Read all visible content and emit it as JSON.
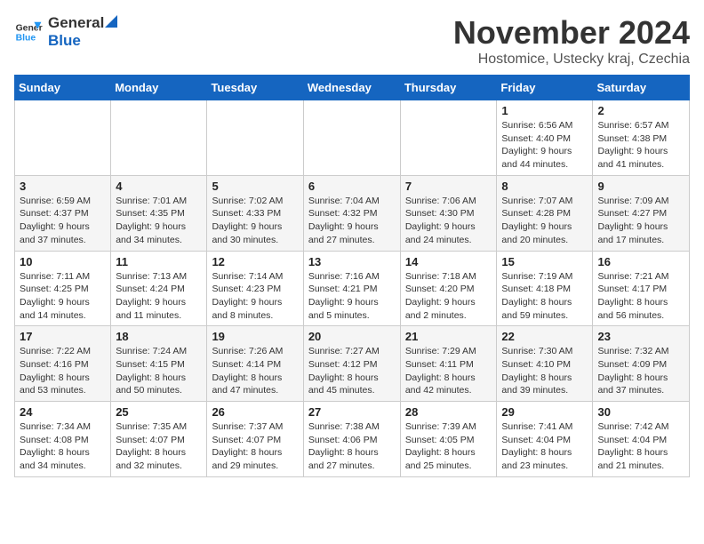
{
  "header": {
    "logo_general": "General",
    "logo_blue": "Blue",
    "month_title": "November 2024",
    "location": "Hostomice, Ustecky kraj, Czechia"
  },
  "weekdays": [
    "Sunday",
    "Monday",
    "Tuesday",
    "Wednesday",
    "Thursday",
    "Friday",
    "Saturday"
  ],
  "weeks": [
    [
      {
        "day": "",
        "info": ""
      },
      {
        "day": "",
        "info": ""
      },
      {
        "day": "",
        "info": ""
      },
      {
        "day": "",
        "info": ""
      },
      {
        "day": "",
        "info": ""
      },
      {
        "day": "1",
        "info": "Sunrise: 6:56 AM\nSunset: 4:40 PM\nDaylight: 9 hours\nand 44 minutes."
      },
      {
        "day": "2",
        "info": "Sunrise: 6:57 AM\nSunset: 4:38 PM\nDaylight: 9 hours\nand 41 minutes."
      }
    ],
    [
      {
        "day": "3",
        "info": "Sunrise: 6:59 AM\nSunset: 4:37 PM\nDaylight: 9 hours\nand 37 minutes."
      },
      {
        "day": "4",
        "info": "Sunrise: 7:01 AM\nSunset: 4:35 PM\nDaylight: 9 hours\nand 34 minutes."
      },
      {
        "day": "5",
        "info": "Sunrise: 7:02 AM\nSunset: 4:33 PM\nDaylight: 9 hours\nand 30 minutes."
      },
      {
        "day": "6",
        "info": "Sunrise: 7:04 AM\nSunset: 4:32 PM\nDaylight: 9 hours\nand 27 minutes."
      },
      {
        "day": "7",
        "info": "Sunrise: 7:06 AM\nSunset: 4:30 PM\nDaylight: 9 hours\nand 24 minutes."
      },
      {
        "day": "8",
        "info": "Sunrise: 7:07 AM\nSunset: 4:28 PM\nDaylight: 9 hours\nand 20 minutes."
      },
      {
        "day": "9",
        "info": "Sunrise: 7:09 AM\nSunset: 4:27 PM\nDaylight: 9 hours\nand 17 minutes."
      }
    ],
    [
      {
        "day": "10",
        "info": "Sunrise: 7:11 AM\nSunset: 4:25 PM\nDaylight: 9 hours\nand 14 minutes."
      },
      {
        "day": "11",
        "info": "Sunrise: 7:13 AM\nSunset: 4:24 PM\nDaylight: 9 hours\nand 11 minutes."
      },
      {
        "day": "12",
        "info": "Sunrise: 7:14 AM\nSunset: 4:23 PM\nDaylight: 9 hours\nand 8 minutes."
      },
      {
        "day": "13",
        "info": "Sunrise: 7:16 AM\nSunset: 4:21 PM\nDaylight: 9 hours\nand 5 minutes."
      },
      {
        "day": "14",
        "info": "Sunrise: 7:18 AM\nSunset: 4:20 PM\nDaylight: 9 hours\nand 2 minutes."
      },
      {
        "day": "15",
        "info": "Sunrise: 7:19 AM\nSunset: 4:18 PM\nDaylight: 8 hours\nand 59 minutes."
      },
      {
        "day": "16",
        "info": "Sunrise: 7:21 AM\nSunset: 4:17 PM\nDaylight: 8 hours\nand 56 minutes."
      }
    ],
    [
      {
        "day": "17",
        "info": "Sunrise: 7:22 AM\nSunset: 4:16 PM\nDaylight: 8 hours\nand 53 minutes."
      },
      {
        "day": "18",
        "info": "Sunrise: 7:24 AM\nSunset: 4:15 PM\nDaylight: 8 hours\nand 50 minutes."
      },
      {
        "day": "19",
        "info": "Sunrise: 7:26 AM\nSunset: 4:14 PM\nDaylight: 8 hours\nand 47 minutes."
      },
      {
        "day": "20",
        "info": "Sunrise: 7:27 AM\nSunset: 4:12 PM\nDaylight: 8 hours\nand 45 minutes."
      },
      {
        "day": "21",
        "info": "Sunrise: 7:29 AM\nSunset: 4:11 PM\nDaylight: 8 hours\nand 42 minutes."
      },
      {
        "day": "22",
        "info": "Sunrise: 7:30 AM\nSunset: 4:10 PM\nDaylight: 8 hours\nand 39 minutes."
      },
      {
        "day": "23",
        "info": "Sunrise: 7:32 AM\nSunset: 4:09 PM\nDaylight: 8 hours\nand 37 minutes."
      }
    ],
    [
      {
        "day": "24",
        "info": "Sunrise: 7:34 AM\nSunset: 4:08 PM\nDaylight: 8 hours\nand 34 minutes."
      },
      {
        "day": "25",
        "info": "Sunrise: 7:35 AM\nSunset: 4:07 PM\nDaylight: 8 hours\nand 32 minutes."
      },
      {
        "day": "26",
        "info": "Sunrise: 7:37 AM\nSunset: 4:07 PM\nDaylight: 8 hours\nand 29 minutes."
      },
      {
        "day": "27",
        "info": "Sunrise: 7:38 AM\nSunset: 4:06 PM\nDaylight: 8 hours\nand 27 minutes."
      },
      {
        "day": "28",
        "info": "Sunrise: 7:39 AM\nSunset: 4:05 PM\nDaylight: 8 hours\nand 25 minutes."
      },
      {
        "day": "29",
        "info": "Sunrise: 7:41 AM\nSunset: 4:04 PM\nDaylight: 8 hours\nand 23 minutes."
      },
      {
        "day": "30",
        "info": "Sunrise: 7:42 AM\nSunset: 4:04 PM\nDaylight: 8 hours\nand 21 minutes."
      }
    ]
  ]
}
